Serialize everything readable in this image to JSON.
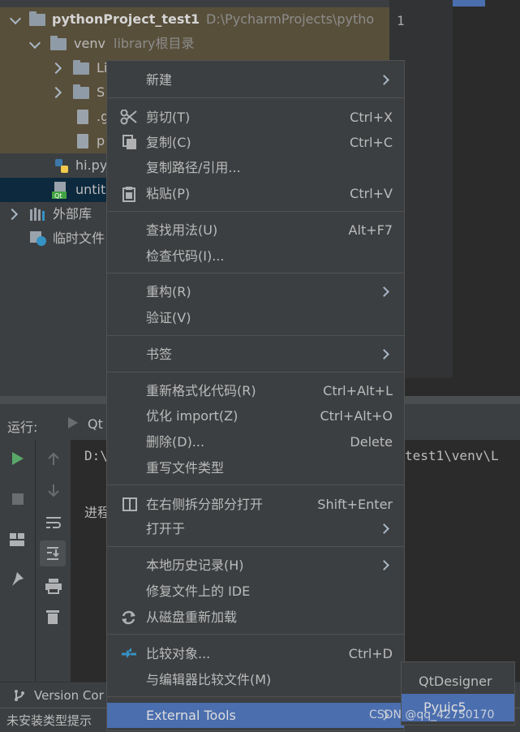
{
  "tree": {
    "project_name": "pythonProject_test1",
    "project_path": "D:\\PycharmProjects\\pytho",
    "venv_label": "venv",
    "venv_hint": "library根目录",
    "lib_folder_1": "Li",
    "lib_folder_2": "S",
    "file_1": ".g",
    "file_2": "p",
    "file_hi": "hi.py",
    "file_untitled": "untit",
    "external_libs": "外部库",
    "scratches": "临时文件"
  },
  "editor": {
    "line_number": "1"
  },
  "run": {
    "label": "运行:",
    "tab_label": "Qt",
    "console_line_1": "D:\\",
    "console_line_1_right": "test1\\venv\\L",
    "console_line_2": "进程"
  },
  "bottom": {
    "version_control": "Version Cor"
  },
  "status": {
    "text": "未安装类型提示"
  },
  "menu": {
    "new": "新建",
    "cut": "剪切(T)",
    "cut_sc": "Ctrl+X",
    "copy": "复制(C)",
    "copy_sc": "Ctrl+C",
    "copy_path": "复制路径/引用...",
    "paste": "粘贴(P)",
    "paste_sc": "Ctrl+V",
    "find_usages": "查找用法(U)",
    "find_usages_sc": "Alt+F7",
    "inspect": "检查代码(I)...",
    "refactor": "重构(R)",
    "validate": "验证(V)",
    "bookmarks": "书签",
    "reformat": "重新格式化代码(R)",
    "reformat_sc": "Ctrl+Alt+L",
    "optimize": "优化 import(Z)",
    "optimize_sc": "Ctrl+Alt+O",
    "delete": "删除(D)...",
    "delete_sc": "Delete",
    "override_type": "重写文件类型",
    "open_split": "在右侧拆分部分打开",
    "open_split_sc": "Shift+Enter",
    "open_in": "打开于",
    "local_history": "本地历史记录(H)",
    "repair_ide": "修复文件上的 IDE",
    "reload": "从磁盘重新加载",
    "compare": "比较对象...",
    "compare_sc": "Ctrl+D",
    "compare_editor": "与编辑器比较文件(M)",
    "external_tools": "External Tools"
  },
  "submenu": {
    "qtdesigner": "QtDesigner",
    "pyuic5": "Pyuic5"
  },
  "watermark": "CSDN @qq_42750170"
}
